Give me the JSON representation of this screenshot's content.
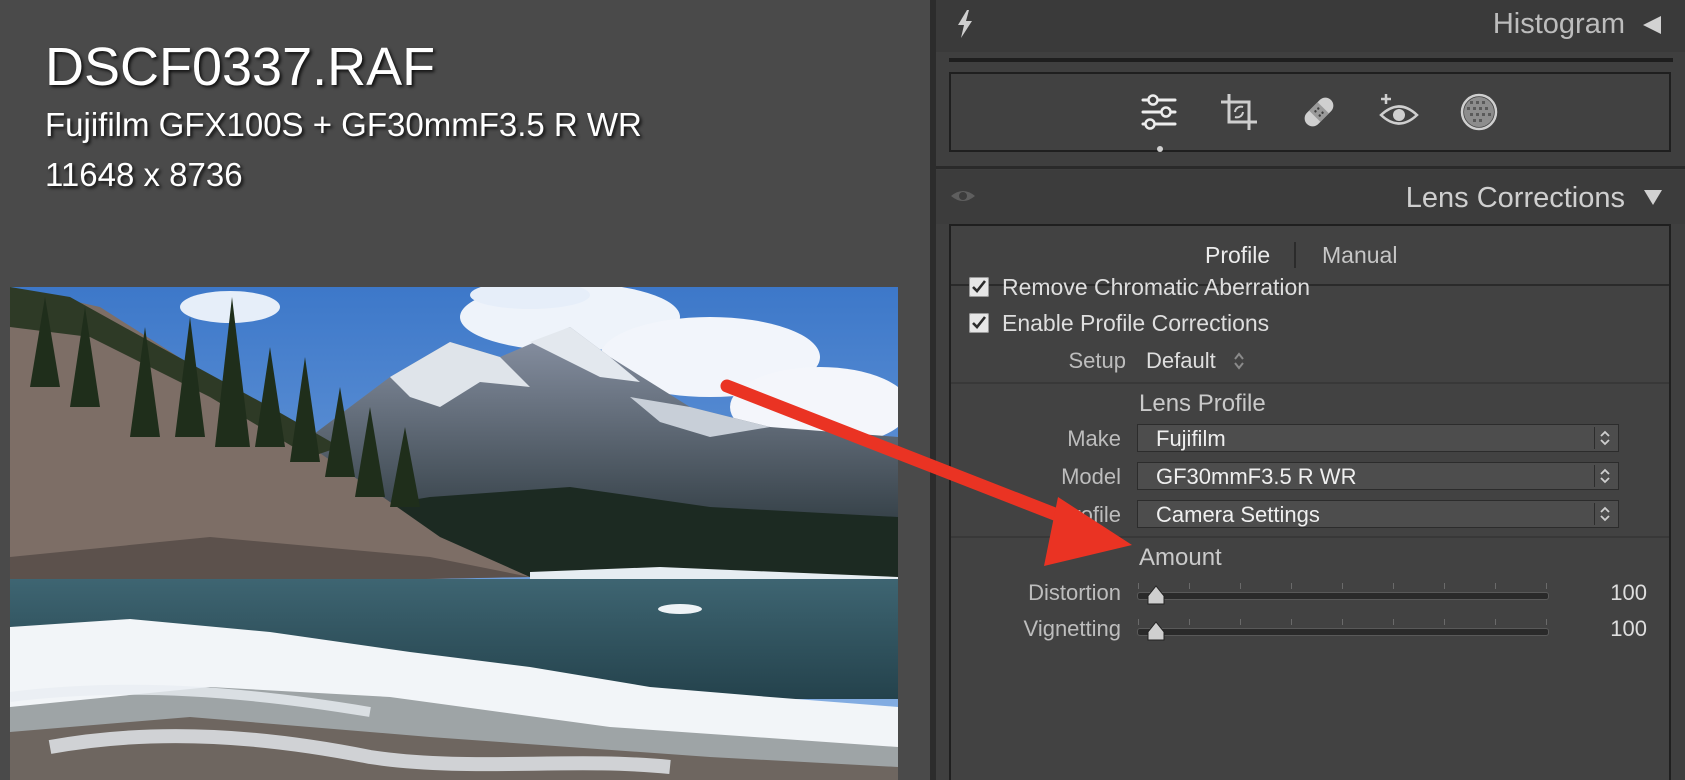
{
  "image_info": {
    "filename": "DSCF0337.RAF",
    "camera": "Fujifilm GFX100S + GF30mmF3.5 R WR",
    "dimensions": "11648 x 8736"
  },
  "panel": {
    "histogram_title": "Histogram",
    "tools": [
      "edit-sliders-icon",
      "crop-icon",
      "healing-icon",
      "red-eye-icon",
      "masking-icon"
    ],
    "active_tool": "edit-sliders-icon",
    "section_title": "Lens Corrections"
  },
  "lens_corrections": {
    "tabs": [
      "Profile",
      "Manual"
    ],
    "active_tab": "Profile",
    "remove_ca": {
      "label": "Remove Chromatic Aberration",
      "checked": true
    },
    "enable_profile": {
      "label": "Enable Profile Corrections",
      "checked": true
    },
    "setup": {
      "label": "Setup",
      "value": "Default"
    },
    "lens_profile": {
      "heading": "Lens Profile",
      "make": {
        "label": "Make",
        "value": "Fujifilm"
      },
      "model": {
        "label": "Model",
        "value": "GF30mmF3.5 R WR"
      },
      "profile": {
        "label": "Profile",
        "value": "Camera Settings"
      }
    },
    "amount": {
      "heading": "Amount",
      "distortion": {
        "label": "Distortion",
        "value": "100"
      },
      "vignetting": {
        "label": "Vignetting",
        "value": "100"
      }
    }
  },
  "annotation": {
    "arrow_color": "#ea3323"
  }
}
